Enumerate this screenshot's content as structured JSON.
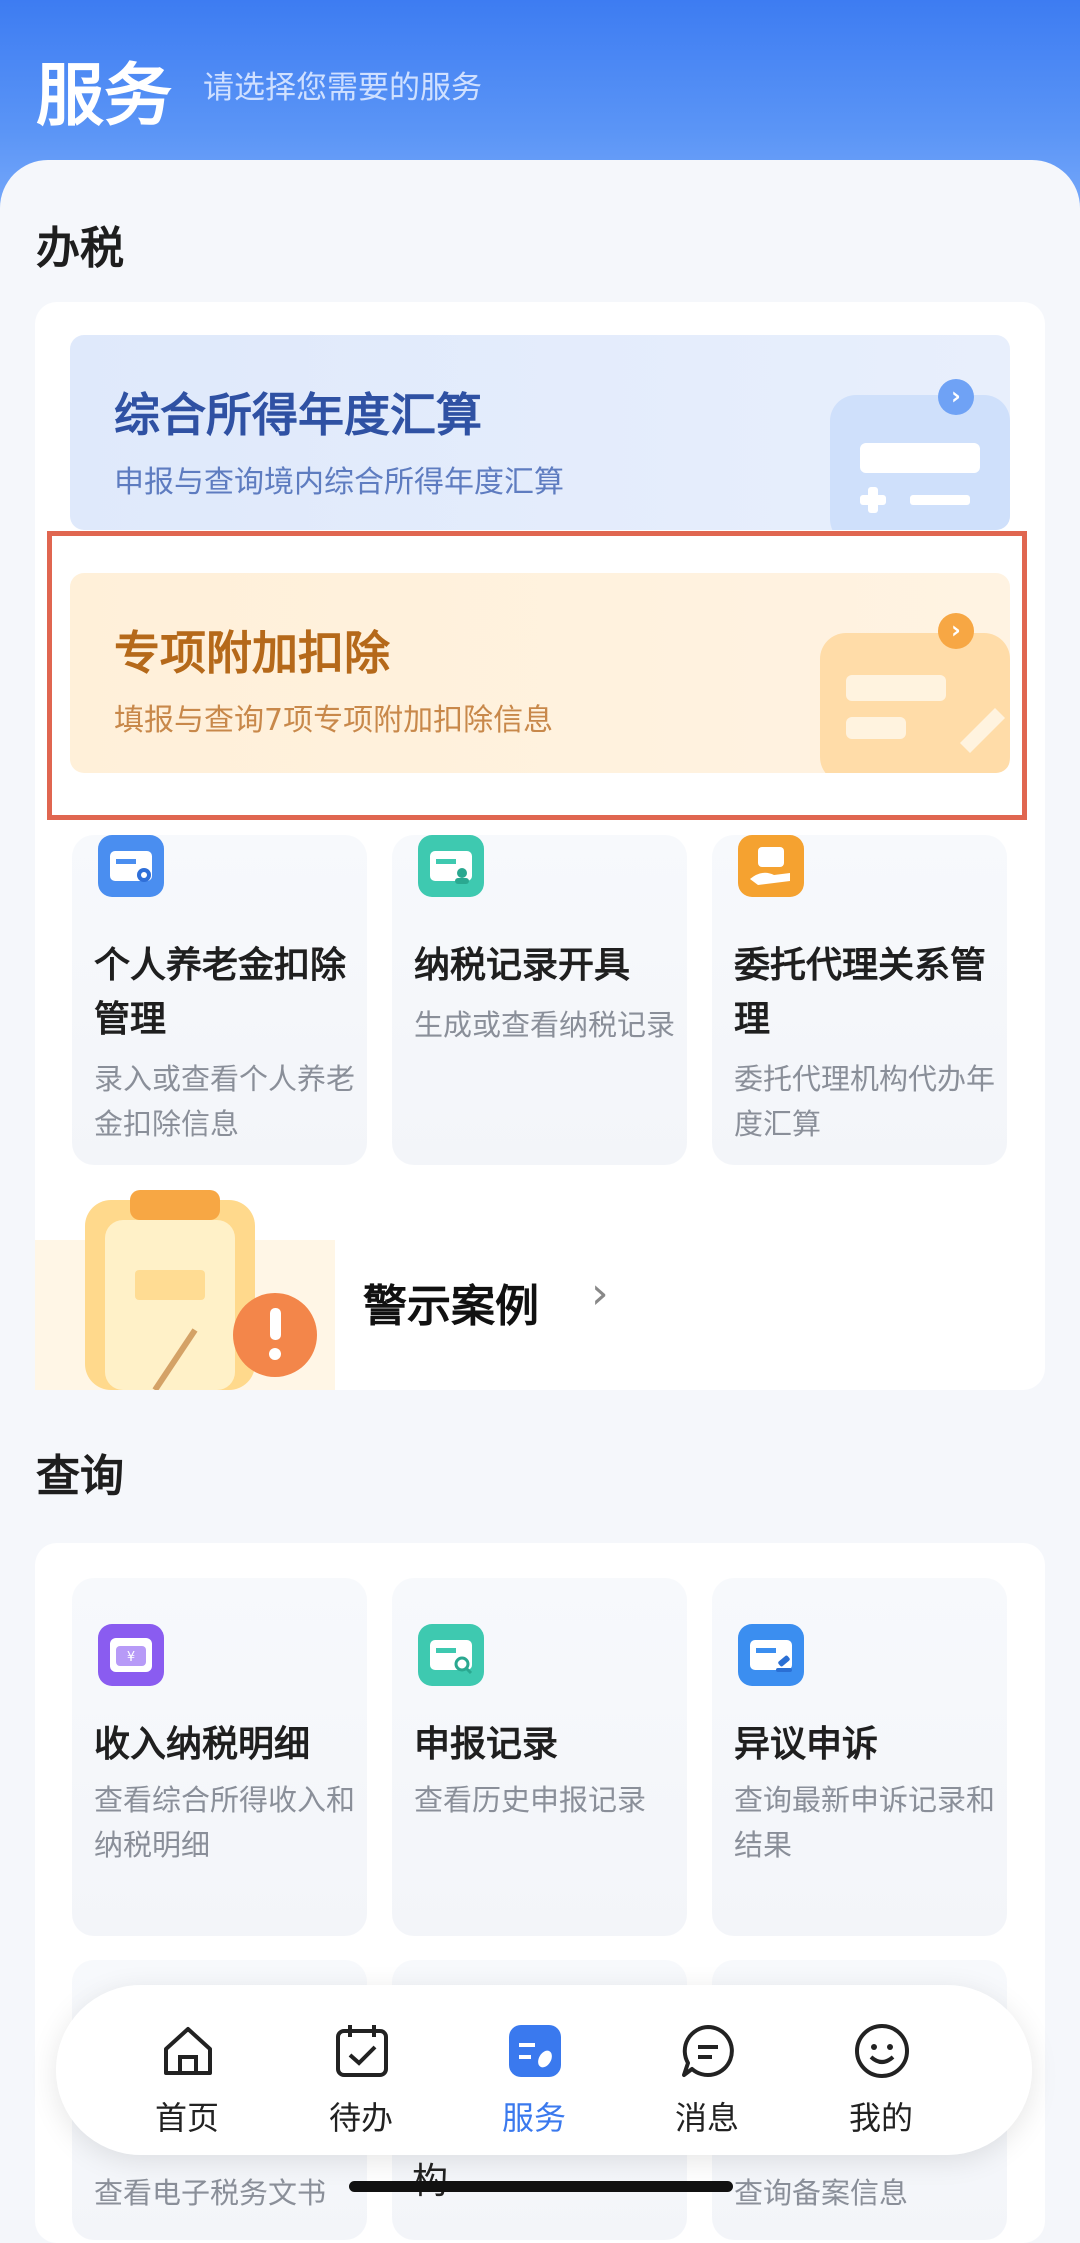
{
  "header": {
    "title": "服务",
    "subtitle": "请选择您需要的服务"
  },
  "tax": {
    "section_title": "办税",
    "banner_annual": {
      "title": "综合所得年度汇算",
      "desc": "申报与查询境内综合所得年度汇算"
    },
    "banner_special": {
      "title": "专项附加扣除",
      "desc": "填报与查询7项专项附加扣除信息"
    },
    "tiles": [
      {
        "title": "个人养老金扣除管理",
        "desc": "录入或查看个人养老金扣除信息",
        "icon": "pension-card-icon",
        "color": "#4a8ef0"
      },
      {
        "title": "纳税记录开具",
        "desc": "生成或查看纳税记录",
        "icon": "tax-record-icon",
        "color": "#3ec9b0"
      },
      {
        "title": "委托代理关系管理",
        "desc": "委托代理机构代办年度汇算",
        "icon": "agent-hand-icon",
        "color": "#f5a230"
      }
    ],
    "warning": {
      "label": "警示案例",
      "arrow": "›"
    }
  },
  "query": {
    "section_title": "查询",
    "tiles": [
      {
        "title": "收入纳税明细",
        "desc": "查看综合所得收入和纳税明细",
        "icon": "wallet-icon",
        "color": "#8a5cf0"
      },
      {
        "title": "申报记录",
        "desc": "查看历史申报记录",
        "icon": "search-record-icon",
        "color": "#3ec9b0"
      },
      {
        "title": "异议申诉",
        "desc": "查询最新申诉记录和结果",
        "icon": "appeal-gavel-icon",
        "color": "#3b8ef0"
      }
    ],
    "peek": {
      "left": "查看电子税务文书",
      "mid": "构",
      "right": "查询备案信息"
    }
  },
  "navbar": {
    "items": [
      {
        "label": "首页",
        "icon": "home-icon"
      },
      {
        "label": "待办",
        "icon": "calendar-check-icon"
      },
      {
        "label": "服务",
        "icon": "service-icon",
        "active": true
      },
      {
        "label": "消息",
        "icon": "message-icon"
      },
      {
        "label": "我的",
        "icon": "smile-icon"
      }
    ],
    "accent": "#3a79ee"
  }
}
